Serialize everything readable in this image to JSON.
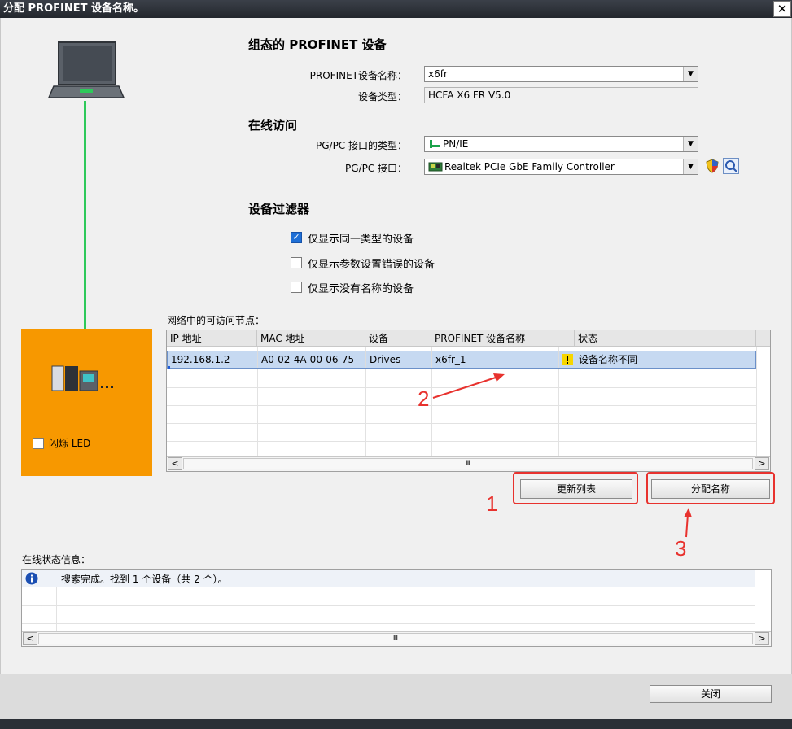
{
  "window": {
    "title": "分配 PROFINET 设备名称。",
    "close_glyph": "✕"
  },
  "configured": {
    "heading": "组态的 PROFINET 设备",
    "name_label": "PROFINET设备名称：",
    "name_value": "x6fr",
    "type_label": "设备类型：",
    "type_value": "HCFA X6 FR V5.0"
  },
  "online": {
    "heading": "在线访问",
    "iface_type_label": "PG/PC 接口的类型：",
    "iface_type_value": "PN/IE",
    "iface_label": "PG/PC 接口：",
    "iface_value": "Realtek PCIe GbE Family Controller"
  },
  "filter": {
    "heading": "设备过滤器",
    "options": [
      {
        "label": "仅显示同一类型的设备",
        "checked": true
      },
      {
        "label": "仅显示参数设置错误的设备",
        "checked": false
      },
      {
        "label": "仅显示没有名称的设备",
        "checked": false
      }
    ]
  },
  "nodes": {
    "label": "网络中的可访问节点：",
    "columns": [
      "IP 地址",
      "MAC 地址",
      "设备",
      "PROFINET 设备名称",
      "状态"
    ],
    "rows": [
      {
        "ip": "192.168.1.2",
        "mac": "A0-02-4A-00-06-75",
        "device": "Drives",
        "name": "x6fr_1",
        "status": "设备名称不同"
      }
    ]
  },
  "flash": {
    "label": "闪烁 LED"
  },
  "buttons": {
    "update_list": "更新列表",
    "assign_name": "分配名称",
    "close": "关闭"
  },
  "annotations": {
    "one": "1",
    "two": "2",
    "three": "3"
  },
  "status": {
    "label": "在线状态信息：",
    "message": "搜索完成。找到 1 个设备（共 2 个）。"
  },
  "scroll_glyph": "Ⅲ",
  "colors": {
    "accent_red": "#e8322e",
    "orange_panel": "#f79800",
    "selection": "#c6d9f1",
    "link_green": "#2ec95a"
  }
}
